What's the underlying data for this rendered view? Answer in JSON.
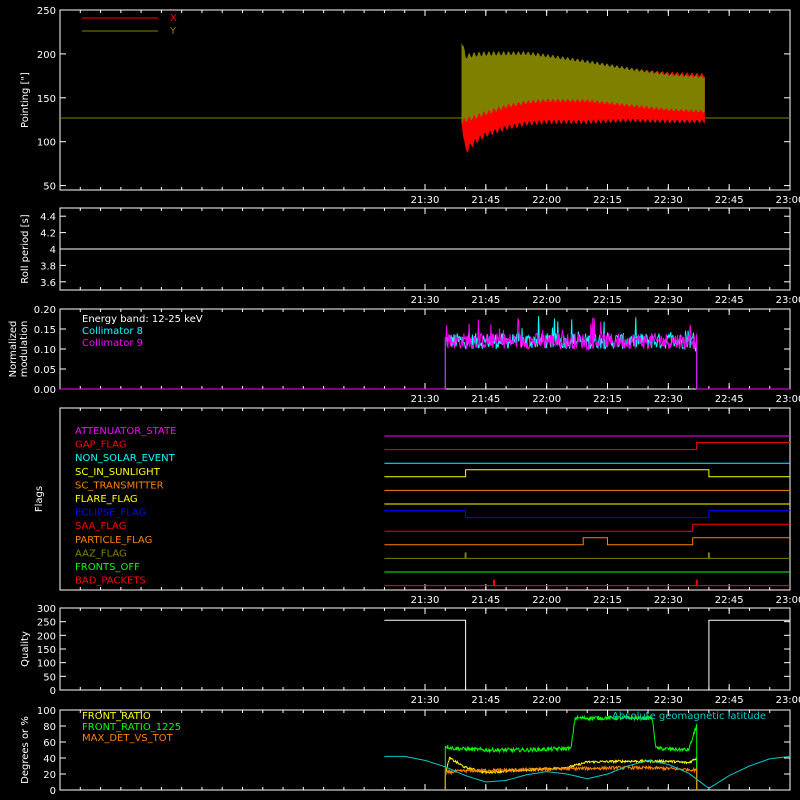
{
  "time_ticks": [
    "21:30",
    "21:45",
    "22:00",
    "22:15",
    "22:30",
    "22:45",
    "23:00"
  ],
  "chart_data": [
    {
      "id": "pointing",
      "type": "line",
      "ylabel": "Pointing [\"]",
      "ylim": [
        45,
        250
      ],
      "yticks": [
        50,
        100,
        150,
        200,
        250
      ],
      "legend": "top-left",
      "series": [
        {
          "name": "X",
          "color": "#ff0000"
        },
        {
          "name": "Y",
          "color": "#808000"
        }
      ],
      "baseline": 127,
      "active_window": [
        "21:39",
        "22:39"
      ],
      "x_envelope": {
        "times": [
          "21:39",
          "21:40",
          "21:42",
          "21:45",
          "21:50",
          "21:55",
          "22:00",
          "22:10",
          "22:20",
          "22:30",
          "22:39"
        ],
        "lower": [
          120,
          85,
          95,
          105,
          113,
          118,
          120,
          120,
          122,
          121,
          121
        ],
        "upper": [
          200,
          195,
          193,
          193,
          194,
          193,
          193,
          188,
          183,
          180,
          178
        ]
      },
      "y_envelope": {
        "times": [
          "21:39",
          "21:40",
          "21:42",
          "21:45",
          "21:50",
          "21:55",
          "22:00",
          "22:10",
          "22:20",
          "22:30",
          "22:39"
        ],
        "lower": [
          120,
          122,
          125,
          130,
          138,
          143,
          145,
          145,
          140,
          135,
          133
        ],
        "upper": [
          220,
          200,
          202,
          203,
          203,
          203,
          200,
          193,
          185,
          178,
          175
        ]
      }
    },
    {
      "id": "roll",
      "type": "line",
      "ylabel": "Roll period [s]",
      "ylim": [
        3.5,
        4.5
      ],
      "yticks": [
        3.6,
        3.8,
        4.0,
        4.2,
        4.4
      ],
      "series": [
        {
          "name": "",
          "color": "#ffffff",
          "values": [
            4.0
          ]
        }
      ]
    },
    {
      "id": "modulation",
      "type": "line",
      "ylabel": [
        "Normalized",
        "modulation"
      ],
      "ylim": [
        0,
        0.2
      ],
      "yticks": [
        0.0,
        0.05,
        0.1,
        0.15,
        0.2
      ],
      "ytick_labels": [
        "0.00",
        "0.05",
        "0.10",
        "0.15",
        "0.20"
      ],
      "annotation": "Energy band: 12-25 keV",
      "active_window": [
        "21:35",
        "22:37"
      ],
      "mean": 0.12,
      "series": [
        {
          "name": "Collimator 8",
          "color": "#00ffff"
        },
        {
          "name": "Collimator 9",
          "color": "#ff00ff"
        }
      ]
    },
    {
      "id": "flags",
      "type": "line",
      "ylabel": "Flags",
      "series": [
        {
          "name": "ATTENUATOR_STATE",
          "color": "#ff00ff",
          "segments": [
            {
              "from": "21:20",
              "to": "23:00",
              "level": 0
            }
          ]
        },
        {
          "name": "GAP_FLAG",
          "color": "#ff0000",
          "segments": [
            {
              "from": "21:20",
              "to": "22:37",
              "level": 0
            },
            {
              "from": "22:37",
              "to": "23:00",
              "level": 1
            }
          ]
        },
        {
          "name": "NON_SOLAR_EVENT",
          "color": "#00ffff",
          "segments": [
            {
              "from": "21:20",
              "to": "23:00",
              "level": 0
            }
          ]
        },
        {
          "name": "SC_IN_SUNLIGHT",
          "color": "#ffff00",
          "segments": [
            {
              "from": "21:20",
              "to": "21:40",
              "level": 0
            },
            {
              "from": "21:40",
              "to": "22:40",
              "level": 1
            },
            {
              "from": "22:40",
              "to": "23:00",
              "level": 0
            }
          ]
        },
        {
          "name": "SC_TRANSMITTER",
          "color": "#ff8000",
          "segments": [
            {
              "from": "21:20",
              "to": "23:00",
              "level": 0
            }
          ]
        },
        {
          "name": "FLARE_FLAG",
          "color": "#ffff00",
          "segments": [
            {
              "from": "21:20",
              "to": "23:00",
              "level": 0
            }
          ]
        },
        {
          "name": "ECLIPSE_FLAG",
          "color": "#0000ff",
          "segments": [
            {
              "from": "21:20",
              "to": "21:40",
              "level": 1
            },
            {
              "from": "21:40",
              "to": "22:40",
              "level": 0
            },
            {
              "from": "22:40",
              "to": "23:00",
              "level": 1
            }
          ]
        },
        {
          "name": "SAA_FLAG",
          "color": "#ff0000",
          "segments": [
            {
              "from": "21:20",
              "to": "22:36",
              "level": 0
            },
            {
              "from": "22:36",
              "to": "23:00",
              "level": 1
            }
          ]
        },
        {
          "name": "PARTICLE_FLAG",
          "color": "#ff8000",
          "segments": [
            {
              "from": "21:20",
              "to": "22:09",
              "level": 0
            },
            {
              "from": "22:09",
              "to": "22:15",
              "level": 1
            },
            {
              "from": "22:15",
              "to": "22:36",
              "level": 0
            },
            {
              "from": "22:36",
              "to": "23:00",
              "level": 1
            }
          ]
        },
        {
          "name": "AAZ_FLAG",
          "color": "#808000",
          "segments": [
            {
              "from": "21:20",
              "to": "23:00",
              "level": 0
            }
          ],
          "spikes": [
            "21:40",
            "22:40"
          ]
        },
        {
          "name": "FRONTS_OFF",
          "color": "#00ff00",
          "segments": [
            {
              "from": "21:20",
              "to": "23:00",
              "level": 0
            }
          ]
        },
        {
          "name": "BAD_PACKETS",
          "color": "#ff0000",
          "segments": [
            {
              "from": "21:20",
              "to": "23:00",
              "level": 0
            }
          ],
          "spikes": [
            "21:47",
            "22:37"
          ]
        }
      ]
    },
    {
      "id": "quality",
      "type": "line",
      "ylabel": "Quality",
      "ylim": [
        0,
        300
      ],
      "yticks": [
        0,
        50,
        100,
        150,
        200,
        250,
        300
      ],
      "series": [
        {
          "name": "",
          "color": "#ffffff",
          "segments": [
            {
              "from": "21:20",
              "to": "21:40",
              "value": 255
            },
            {
              "from": "21:40",
              "to": "22:40",
              "value": 0
            },
            {
              "from": "22:40",
              "to": "23:00",
              "value": 255
            }
          ]
        }
      ]
    },
    {
      "id": "ratios",
      "type": "line",
      "ylabel": "Degrees or %",
      "ylim": [
        0,
        100
      ],
      "yticks": [
        0,
        20,
        40,
        60,
        80,
        100
      ],
      "series": [
        {
          "name": "FRONT_RATIO",
          "color": "#ffff00",
          "times": [
            "21:35",
            "21:36",
            "21:40",
            "21:45",
            "21:55",
            "22:05",
            "22:08",
            "22:10",
            "22:20",
            "22:30",
            "22:35",
            "22:37"
          ],
          "values": [
            18,
            40,
            28,
            22,
            25,
            28,
            32,
            35,
            36,
            36,
            34,
            40
          ]
        },
        {
          "name": "FRONT_RATIO_1225",
          "color": "#00ff00",
          "times": [
            "21:35",
            "21:37",
            "21:45",
            "21:55",
            "22:06",
            "22:07",
            "22:15",
            "22:26",
            "22:27",
            "22:35",
            "22:36",
            "22:37"
          ],
          "values": [
            55,
            52,
            50,
            50,
            52,
            90,
            90,
            90,
            52,
            50,
            65,
            82
          ]
        },
        {
          "name": "MAX_DET_VS_TOT",
          "color": "#ff8000",
          "times": [
            "21:35",
            "21:40",
            "21:50",
            "22:00",
            "22:10",
            "22:20",
            "22:30",
            "22:37"
          ],
          "values": [
            22,
            24,
            25,
            26,
            27,
            28,
            27,
            25
          ]
        },
        {
          "name": "Absolute geomagnetic latitude",
          "color": "#00cccc",
          "times": [
            "21:20",
            "21:25",
            "21:30",
            "21:35",
            "21:40",
            "21:45",
            "21:50",
            "21:55",
            "22:00",
            "22:05",
            "22:10",
            "22:15",
            "22:20",
            "22:25",
            "22:30",
            "22:35",
            "22:40",
            "22:45",
            "22:50",
            "22:55",
            "23:00"
          ],
          "values": [
            42,
            42,
            37,
            29,
            18,
            10,
            12,
            19,
            23,
            20,
            14,
            20,
            30,
            37,
            32,
            21,
            2,
            18,
            30,
            39,
            42
          ]
        }
      ]
    }
  ]
}
